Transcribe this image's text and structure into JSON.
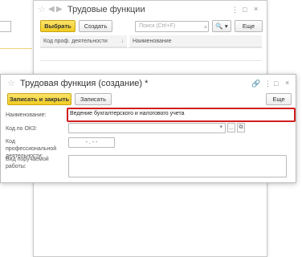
{
  "back_window": {
    "title": "Трудовые функции",
    "select_label": "Выбрать",
    "create_label": "Создать",
    "search_placeholder": "Поиск (Ctrl+F)",
    "search_clear": "×",
    "search_go": "🔍 ▾",
    "more_label": "Еще",
    "columns": [
      "Код проф. деятельности",
      "Наименование"
    ],
    "sort_arrow": "↓"
  },
  "dialog": {
    "title": "Трудовая функция (создание) *",
    "save_close_label": "Записать и закрыть",
    "save_label": "Записать",
    "more_label": "Еще",
    "name_label": "Наименование:",
    "name_value": "Ведение бухгалтерского и налогового учета",
    "okz_label": "Код по ОКЗ:",
    "prof_code_label": "Код профессиональной деятельности:",
    "prof_code_value": "- . - -",
    "work_label": "Вид поручаемой работы:",
    "dots": "...",
    "window_controls": [
      "🔗",
      "⋮",
      "□",
      "×"
    ]
  },
  "colors": {
    "primary": "#f3d033",
    "highlight": "#d11f1f"
  }
}
